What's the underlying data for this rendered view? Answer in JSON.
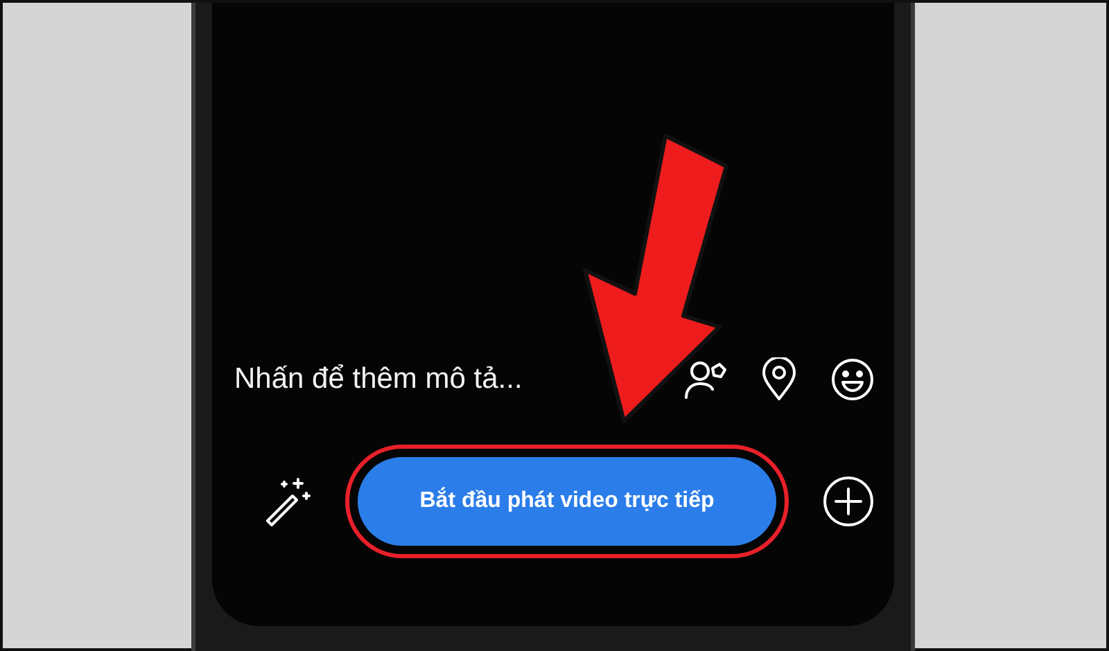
{
  "composer": {
    "description_prompt": "Nhấn để thêm mô tả..."
  },
  "live_button": {
    "label": "Bắt đầu phát video trực tiếp",
    "highlighted": true
  }
}
